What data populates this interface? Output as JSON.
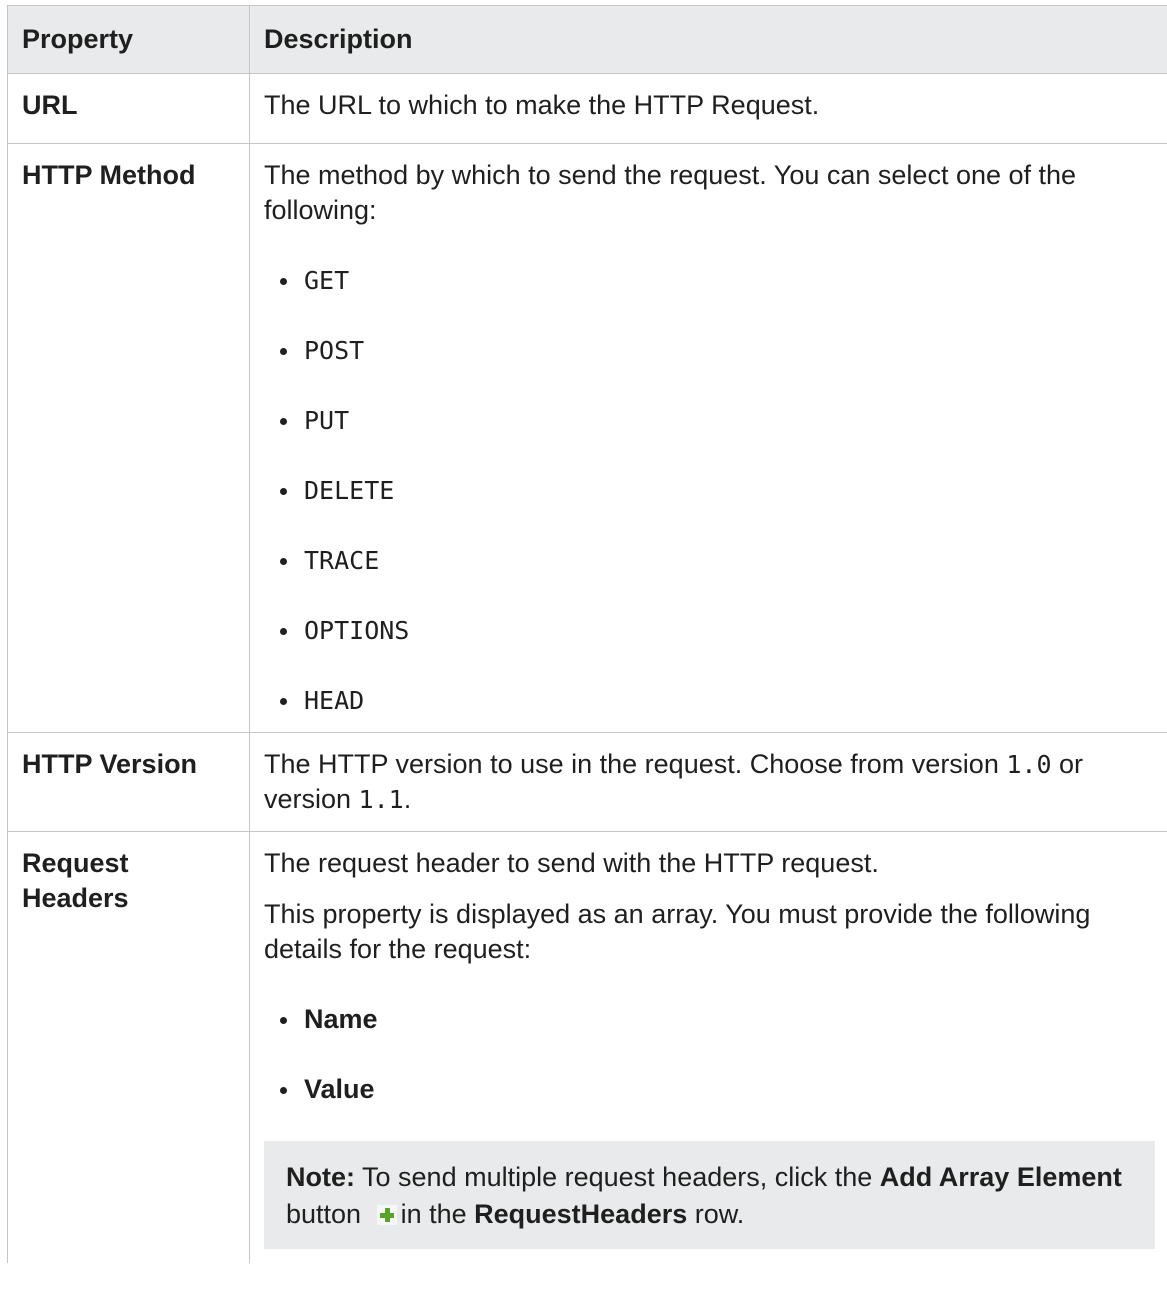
{
  "header": {
    "property": "Property",
    "description": "Description"
  },
  "rows": {
    "url": {
      "name": "URL",
      "description": "The URL to which to make the HTTP Request."
    },
    "method": {
      "name": "HTTP Method",
      "description": "The method by which to send the request. You can select one of the following:",
      "options": [
        "GET",
        "POST",
        "PUT",
        "DELETE",
        "TRACE",
        "OPTIONS",
        "HEAD"
      ]
    },
    "version": {
      "name": "HTTP Version",
      "text_before": "The HTTP version to use in the request. Choose from version ",
      "version_a": "1.0",
      "text_middle": " or version ",
      "version_b": "1.1",
      "text_after": "."
    },
    "headers": {
      "name_line1": "Request",
      "name_line2": "Headers",
      "description": "The request header to send with the HTTP request.",
      "array_text": "This property is displayed as an array. You must provide the following details for the request:",
      "fields": [
        "Name",
        "Value"
      ],
      "note": {
        "label": "Note:",
        "text1": " To send multiple request headers, click the ",
        "button_name": "Add Array Element",
        "text2": " button ",
        "text3": "in the ",
        "row_name": "RequestHeaders",
        "text4": " row.",
        "icon": "plus-icon"
      }
    }
  },
  "colors": {
    "header_bg": "#e9eaeb",
    "border": "#c6c6c6",
    "note_bg": "#e9eaeb",
    "plus_icon": "#5aa329"
  }
}
